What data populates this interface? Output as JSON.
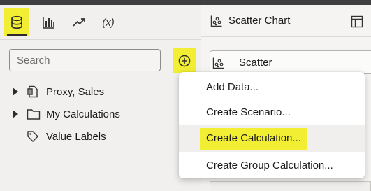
{
  "left_panel": {
    "toolbar": {
      "tabs": [
        {
          "name": "data",
          "icon": "database-icon",
          "active": true
        },
        {
          "name": "visualizations",
          "icon": "bar-chart-icon",
          "active": false
        },
        {
          "name": "analytics",
          "icon": "trend-arrow-icon",
          "active": false
        },
        {
          "name": "calculations",
          "icon": "fx-icon",
          "label": "(x)",
          "active": false
        }
      ]
    },
    "search": {
      "placeholder": "Search",
      "value": ""
    },
    "add_button_icon": "plus-circle-icon",
    "tree": [
      {
        "label": "Proxy, Sales",
        "icon": "dataset-icon",
        "expandable": true
      },
      {
        "label": "My Calculations",
        "icon": "folder-icon",
        "expandable": true
      },
      {
        "label": "Value Labels",
        "icon": "tag-icon",
        "expandable": false
      }
    ]
  },
  "right_panel": {
    "header": {
      "title": "Scatter Chart",
      "icon": "scatter-chart-icon",
      "right_icon": "layout-panel-icon"
    },
    "viz_type": {
      "label": "Scatter",
      "icon": "scatter-chart-icon"
    }
  },
  "menu": {
    "items": [
      {
        "label": "Add Data..."
      },
      {
        "label": "Create Scenario..."
      },
      {
        "label": "Create Calculation...",
        "highlighted": true
      },
      {
        "label": "Create Group Calculation..."
      }
    ]
  },
  "colors": {
    "highlight": "#f2ee33",
    "panel_bg": "#f1f0ee",
    "menu_bg": "#ffffff",
    "topbar": "#3f3f42"
  }
}
